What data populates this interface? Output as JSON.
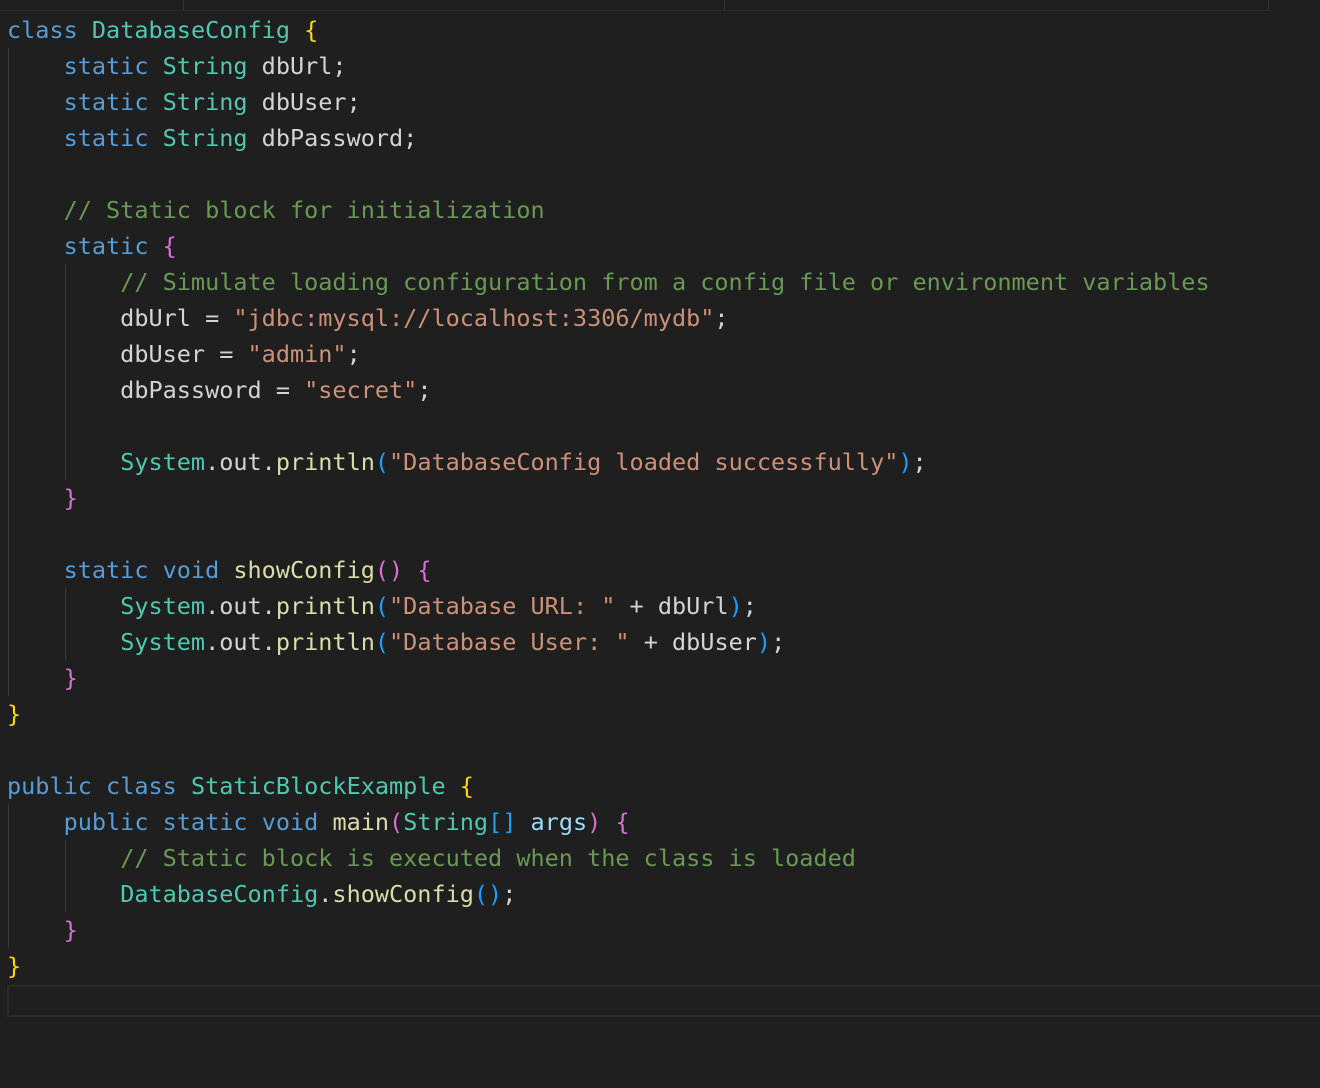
{
  "colors": {
    "background": "#1f1f1f",
    "keyword": "#569cd6",
    "type": "#4ec9b0",
    "function": "#dcdcaa",
    "string": "#ce9178",
    "comment": "#6a9955",
    "variable": "#9cdcfe",
    "bracket_level1": "#ffd700",
    "bracket_level2": "#da70d6",
    "bracket_level3": "#179fff",
    "plain": "#d4d4d4"
  },
  "lines": [
    [
      {
        "t": "class",
        "c": "kw"
      },
      {
        "t": " ",
        "c": "pl"
      },
      {
        "t": "DatabaseConfig",
        "c": "ty"
      },
      {
        "t": " ",
        "c": "pl"
      },
      {
        "t": "{",
        "c": "b1"
      }
    ],
    [
      {
        "t": "    ",
        "c": "pl"
      },
      {
        "t": "static",
        "c": "kw"
      },
      {
        "t": " ",
        "c": "pl"
      },
      {
        "t": "String",
        "c": "ty"
      },
      {
        "t": " dbUrl;",
        "c": "pl"
      }
    ],
    [
      {
        "t": "    ",
        "c": "pl"
      },
      {
        "t": "static",
        "c": "kw"
      },
      {
        "t": " ",
        "c": "pl"
      },
      {
        "t": "String",
        "c": "ty"
      },
      {
        "t": " dbUser;",
        "c": "pl"
      }
    ],
    [
      {
        "t": "    ",
        "c": "pl"
      },
      {
        "t": "static",
        "c": "kw"
      },
      {
        "t": " ",
        "c": "pl"
      },
      {
        "t": "String",
        "c": "ty"
      },
      {
        "t": " dbPassword;",
        "c": "pl"
      }
    ],
    [],
    [
      {
        "t": "    ",
        "c": "pl"
      },
      {
        "t": "// Static block for initialization",
        "c": "cm"
      }
    ],
    [
      {
        "t": "    ",
        "c": "pl"
      },
      {
        "t": "static",
        "c": "kw"
      },
      {
        "t": " ",
        "c": "pl"
      },
      {
        "t": "{",
        "c": "b2"
      }
    ],
    [
      {
        "t": "        ",
        "c": "pl"
      },
      {
        "t": "// Simulate loading configuration from a config file or environment variables",
        "c": "cm"
      }
    ],
    [
      {
        "t": "        dbUrl = ",
        "c": "pl"
      },
      {
        "t": "\"jdbc:mysql://localhost:3306/mydb\"",
        "c": "str"
      },
      {
        "t": ";",
        "c": "pl"
      }
    ],
    [
      {
        "t": "        dbUser = ",
        "c": "pl"
      },
      {
        "t": "\"admin\"",
        "c": "str"
      },
      {
        "t": ";",
        "c": "pl"
      }
    ],
    [
      {
        "t": "        dbPassword = ",
        "c": "pl"
      },
      {
        "t": "\"secret\"",
        "c": "str"
      },
      {
        "t": ";",
        "c": "pl"
      }
    ],
    [],
    [
      {
        "t": "        ",
        "c": "pl"
      },
      {
        "t": "System",
        "c": "ty"
      },
      {
        "t": ".out.",
        "c": "pl"
      },
      {
        "t": "println",
        "c": "fn"
      },
      {
        "t": "(",
        "c": "b3"
      },
      {
        "t": "\"DatabaseConfig loaded successfully\"",
        "c": "str"
      },
      {
        "t": ")",
        "c": "b3"
      },
      {
        "t": ";",
        "c": "pl"
      }
    ],
    [
      {
        "t": "    ",
        "c": "pl"
      },
      {
        "t": "}",
        "c": "b2"
      }
    ],
    [],
    [
      {
        "t": "    ",
        "c": "pl"
      },
      {
        "t": "static",
        "c": "kw"
      },
      {
        "t": " ",
        "c": "pl"
      },
      {
        "t": "void",
        "c": "kw"
      },
      {
        "t": " ",
        "c": "pl"
      },
      {
        "t": "showConfig",
        "c": "fn"
      },
      {
        "t": "()",
        "c": "b2"
      },
      {
        "t": " ",
        "c": "pl"
      },
      {
        "t": "{",
        "c": "b2"
      }
    ],
    [
      {
        "t": "        ",
        "c": "pl"
      },
      {
        "t": "System",
        "c": "ty"
      },
      {
        "t": ".out.",
        "c": "pl"
      },
      {
        "t": "println",
        "c": "fn"
      },
      {
        "t": "(",
        "c": "b3"
      },
      {
        "t": "\"Database URL: \"",
        "c": "str"
      },
      {
        "t": " + dbUrl",
        "c": "pl"
      },
      {
        "t": ")",
        "c": "b3"
      },
      {
        "t": ";",
        "c": "pl"
      }
    ],
    [
      {
        "t": "        ",
        "c": "pl"
      },
      {
        "t": "System",
        "c": "ty"
      },
      {
        "t": ".out.",
        "c": "pl"
      },
      {
        "t": "println",
        "c": "fn"
      },
      {
        "t": "(",
        "c": "b3"
      },
      {
        "t": "\"Database User: \"",
        "c": "str"
      },
      {
        "t": " + dbUser",
        "c": "pl"
      },
      {
        "t": ")",
        "c": "b3"
      },
      {
        "t": ";",
        "c": "pl"
      }
    ],
    [
      {
        "t": "    ",
        "c": "pl"
      },
      {
        "t": "}",
        "c": "b2"
      }
    ],
    [
      {
        "t": "}",
        "c": "b1"
      }
    ],
    [],
    [
      {
        "t": "public",
        "c": "kw"
      },
      {
        "t": " ",
        "c": "pl"
      },
      {
        "t": "class",
        "c": "kw"
      },
      {
        "t": " ",
        "c": "pl"
      },
      {
        "t": "StaticBlockExample",
        "c": "ty"
      },
      {
        "t": " ",
        "c": "pl"
      },
      {
        "t": "{",
        "c": "b1"
      }
    ],
    [
      {
        "t": "    ",
        "c": "pl"
      },
      {
        "t": "public",
        "c": "kw"
      },
      {
        "t": " ",
        "c": "pl"
      },
      {
        "t": "static",
        "c": "kw"
      },
      {
        "t": " ",
        "c": "pl"
      },
      {
        "t": "void",
        "c": "kw"
      },
      {
        "t": " ",
        "c": "pl"
      },
      {
        "t": "main",
        "c": "fn"
      },
      {
        "t": "(",
        "c": "b2"
      },
      {
        "t": "String",
        "c": "ty"
      },
      {
        "t": "[]",
        "c": "b3"
      },
      {
        "t": " ",
        "c": "pl"
      },
      {
        "t": "args",
        "c": "var"
      },
      {
        "t": ")",
        "c": "b2"
      },
      {
        "t": " ",
        "c": "pl"
      },
      {
        "t": "{",
        "c": "b2"
      }
    ],
    [
      {
        "t": "        ",
        "c": "pl"
      },
      {
        "t": "// Static block is executed when the class is loaded",
        "c": "cm"
      }
    ],
    [
      {
        "t": "        ",
        "c": "pl"
      },
      {
        "t": "DatabaseConfig",
        "c": "ty"
      },
      {
        "t": ".",
        "c": "pl"
      },
      {
        "t": "showConfig",
        "c": "fn"
      },
      {
        "t": "()",
        "c": "b3"
      },
      {
        "t": ";",
        "c": "pl"
      }
    ],
    [
      {
        "t": "    ",
        "c": "pl"
      },
      {
        "t": "}",
        "c": "b2"
      }
    ],
    [
      {
        "t": "}",
        "c": "b1"
      }
    ]
  ]
}
